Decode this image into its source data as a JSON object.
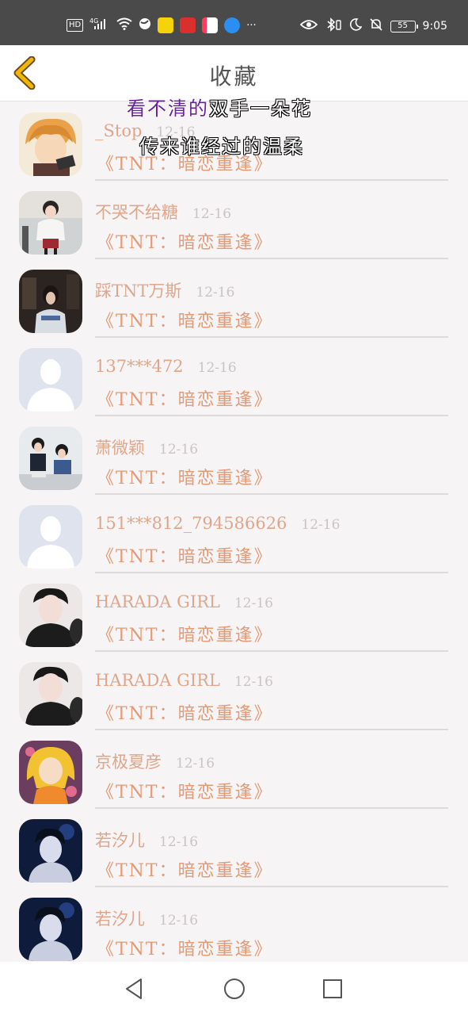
{
  "status_bar": {
    "hd": "HD",
    "net": "4G",
    "battery": "55",
    "time": "9:05",
    "more": "···"
  },
  "header": {
    "title": "收藏"
  },
  "lyrics": {
    "line1_highlight": "看不清的",
    "line1_rest": "双手一朵花",
    "line2": "传来谁经过的温柔"
  },
  "rows": [
    {
      "name": "_Stop",
      "date": "12-16",
      "work": "《TNT：暗恋重逢》",
      "avatar": "anime-boy-orange-hair"
    },
    {
      "name": "不哭不给糖",
      "date": "12-16",
      "work": "《TNT：暗恋重逢》",
      "avatar": "girl-white-jacket"
    },
    {
      "name": "踩TNT万斯",
      "date": "12-16",
      "work": "《TNT：暗恋重逢》",
      "avatar": "girl-dark-room"
    },
    {
      "name": "137***472",
      "date": "12-16",
      "work": "《TNT：暗恋重逢》",
      "avatar": "default-avatar"
    },
    {
      "name": "萧微颖",
      "date": "12-16",
      "work": "《TNT：暗恋重逢》",
      "avatar": "two-boys"
    },
    {
      "name": "151***812_794586626",
      "date": "12-16",
      "work": "《TNT：暗恋重逢》",
      "avatar": "default-avatar"
    },
    {
      "name": "HARADA GIRL",
      "date": "12-16",
      "work": "《TNT：暗恋重逢》",
      "avatar": "boy-black-shirt"
    },
    {
      "name": "HARADA GIRL",
      "date": "12-16",
      "work": "《TNT：暗恋重逢》",
      "avatar": "boy-black-shirt"
    },
    {
      "name": "京极夏彦",
      "date": "12-16",
      "work": "《TNT：暗恋重逢》",
      "avatar": "anime-girl-yellow-hair"
    },
    {
      "name": "若汐儿",
      "date": "12-16",
      "work": "《TNT：暗恋重逢》",
      "avatar": "boy-blue-stage"
    },
    {
      "name": "若汐儿",
      "date": "12-16",
      "work": "《TNT：暗恋重逢》",
      "avatar": "boy-blue-stage"
    }
  ],
  "colors": {
    "name": "#dea68b",
    "work": "#e29a77",
    "date": "#c9c4c6",
    "accent": "#f2b705"
  }
}
